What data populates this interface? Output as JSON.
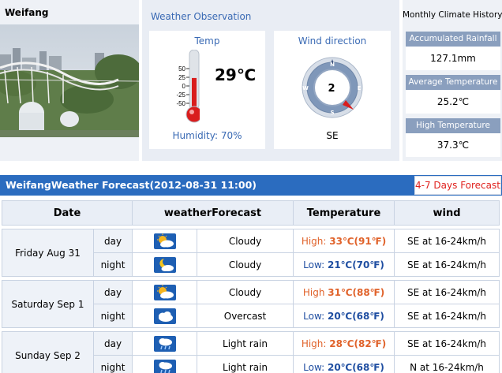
{
  "city": {
    "name": "Weifang"
  },
  "observation": {
    "title": "Weather Observation",
    "temp": {
      "title": "Temp",
      "value": "29℃",
      "scale": [
        "50",
        "25",
        "0",
        "-25",
        "-50"
      ],
      "level": 0.58
    },
    "humidity": {
      "label": "Humidity",
      "value": "70%"
    },
    "wind": {
      "title": "Wind direction",
      "speed": "2",
      "direction": "SE",
      "compass": [
        "N",
        "E",
        "S",
        "W"
      ]
    }
  },
  "climate": {
    "title": "Monthly Climate History",
    "items": [
      {
        "label": "Accumulated Rainfall",
        "value": "127.1mm"
      },
      {
        "label": "Average Temperature",
        "value": "25.2℃"
      },
      {
        "label": "High Temperature",
        "value": "37.3℃"
      }
    ]
  },
  "forecast": {
    "title": "WeifangWeather Forecast(2012-08-31  11:00)",
    "link": "4-7 Days Forecast",
    "headers": [
      "Date",
      "weatherForecast",
      "Temperature",
      "wind"
    ],
    "days": [
      {
        "date": "Friday Aug 31",
        "day": {
          "period": "day",
          "icon": "sun-cloud-icon",
          "weather": "Cloudy",
          "temp_label": "High: ",
          "temp": "33℃(91℉)",
          "wind": "SE at 16-24km/h"
        },
        "night": {
          "period": "night",
          "icon": "moon-cloud-icon",
          "weather": "Cloudy",
          "temp_label": "Low: ",
          "temp": "21℃(70℉)",
          "wind": "SE at 16-24km/h"
        }
      },
      {
        "date": "Saturday Sep 1",
        "day": {
          "period": "day",
          "icon": "sun-cloud-icon",
          "weather": "Cloudy",
          "temp_label": "High ",
          "temp": "31℃(88℉)",
          "wind": "SE at 16-24km/h"
        },
        "night": {
          "period": "night",
          "icon": "cloud-icon",
          "weather": "Overcast",
          "temp_label": "Low: ",
          "temp": "20℃(68℉)",
          "wind": "SE at 16-24km/h"
        }
      },
      {
        "date": "Sunday Sep 2",
        "day": {
          "period": "day",
          "icon": "rain-icon",
          "weather": "Light rain",
          "temp_label": "High: ",
          "temp": "28℃(82℉)",
          "wind": "SE at 16-24km/h"
        },
        "night": {
          "period": "night",
          "icon": "rain-icon",
          "weather": "Light rain",
          "temp_label": "Low: ",
          "temp": "20℃(68℉)",
          "wind": "N at 16-24km/h"
        }
      }
    ]
  },
  "colors": {
    "accent": "#2b6cbf",
    "high": "#e0622a",
    "low": "#1f4ea1",
    "link": "#e0221e"
  }
}
